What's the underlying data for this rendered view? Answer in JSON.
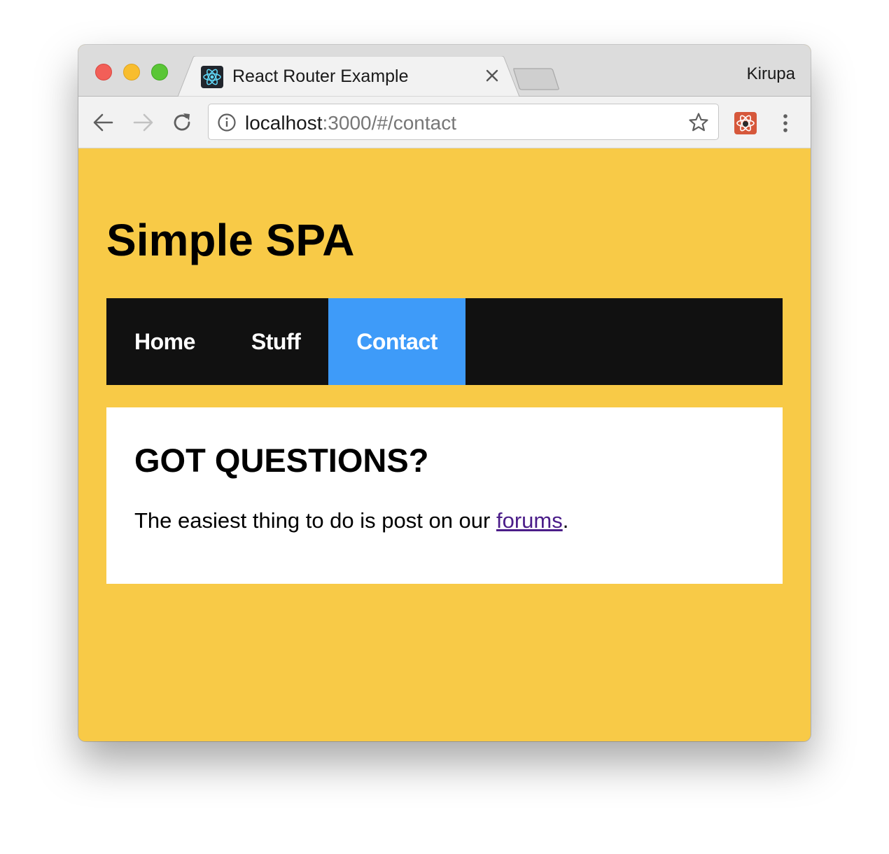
{
  "browser": {
    "tab": {
      "title": "React Router Example",
      "favicon": "react-logo-icon"
    },
    "profile_name": "Kirupa",
    "address_bar": {
      "host": "localhost",
      "path": ":3000/#/contact"
    },
    "icons": {
      "back": "arrow-left-icon",
      "forward": "arrow-right-icon",
      "reload": "reload-icon",
      "info": "info-icon",
      "bookmark": "star-icon",
      "extension": "react-devtools-icon",
      "menu": "vertical-dots-icon",
      "close": "close-icon"
    }
  },
  "page": {
    "title": "Simple SPA",
    "nav": [
      {
        "label": "Home",
        "active": false
      },
      {
        "label": "Stuff",
        "active": false
      },
      {
        "label": "Contact",
        "active": true
      }
    ],
    "content": {
      "heading": "GOT QUESTIONS?",
      "text_before": "The easiest thing to do is post on our ",
      "link": "forums",
      "text_after": "."
    }
  },
  "colors": {
    "page_background": "#f8ca47",
    "nav_background": "#111111",
    "nav_active": "#3e9bf9",
    "link": "#4b1d89"
  }
}
